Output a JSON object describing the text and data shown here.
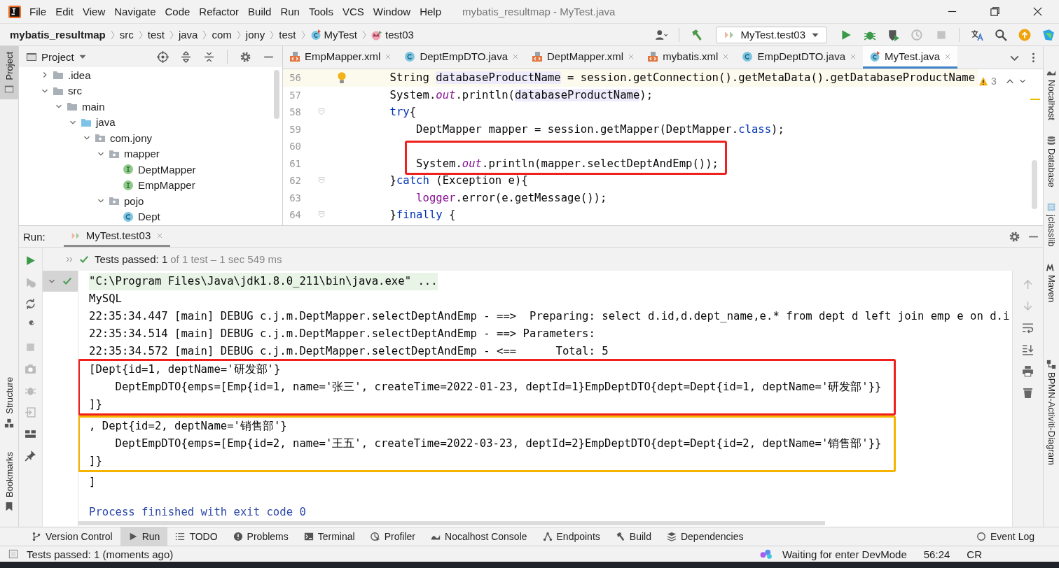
{
  "menu_bar": {
    "items": [
      "File",
      "Edit",
      "View",
      "Navigate",
      "Code",
      "Refactor",
      "Build",
      "Run",
      "Tools",
      "VCS",
      "Window",
      "Help"
    ],
    "title": "mybatis_resultmap - MyTest.java"
  },
  "breadcrumbs": [
    {
      "label": "mybatis_resultmap",
      "kind": "project"
    },
    {
      "label": "src",
      "kind": "dir"
    },
    {
      "label": "test",
      "kind": "dir"
    },
    {
      "label": "java",
      "kind": "dir"
    },
    {
      "label": "com",
      "kind": "dir"
    },
    {
      "label": "jony",
      "kind": "dir"
    },
    {
      "label": "test",
      "kind": "dir"
    },
    {
      "label": "MyTest",
      "kind": "class"
    },
    {
      "label": "test03",
      "kind": "method"
    }
  ],
  "toolbar": {
    "run_config": "MyTest.test03"
  },
  "left_stripe": [
    {
      "label": "Project",
      "selected": true
    },
    {
      "label": "Structure",
      "selected": false
    },
    {
      "label": "Bookmarks",
      "selected": false
    }
  ],
  "right_stripe": [
    "Nocalhost",
    "Database",
    "jclasslib",
    "Maven",
    "BPMN-Activiti-Diagram"
  ],
  "project": {
    "title": "Project",
    "tree": [
      {
        "label": ".idea",
        "kind": "folder",
        "expanded": false
      },
      {
        "label": "src",
        "kind": "folder",
        "expanded": true,
        "children": [
          {
            "label": "main",
            "kind": "folder",
            "expanded": true,
            "children": [
              {
                "label": "java",
                "kind": "source",
                "expanded": true,
                "children": [
                  {
                    "label": "com.jony",
                    "kind": "package",
                    "expanded": true,
                    "children": [
                      {
                        "label": "mapper",
                        "kind": "package",
                        "expanded": true,
                        "children": [
                          {
                            "label": "DeptMapper",
                            "kind": "interface"
                          },
                          {
                            "label": "EmpMapper",
                            "kind": "interface"
                          }
                        ]
                      },
                      {
                        "label": "pojo",
                        "kind": "package",
                        "expanded": true,
                        "children": [
                          {
                            "label": "Dept",
                            "kind": "class"
                          }
                        ]
                      }
                    ]
                  }
                ]
              }
            ]
          }
        ]
      }
    ]
  },
  "editor": {
    "tabs": [
      {
        "label": "EmpMapper.xml",
        "kind": "xml",
        "selected": false
      },
      {
        "label": "DeptEmpDTO.java",
        "kind": "class",
        "selected": false
      },
      {
        "label": "DeptMapper.xml",
        "kind": "xml",
        "selected": false
      },
      {
        "label": "mybatis.xml",
        "kind": "xml",
        "selected": false
      },
      {
        "label": "EmpDeptDTO.java",
        "kind": "class",
        "selected": false
      },
      {
        "label": "MyTest.java",
        "kind": "test-class",
        "selected": true
      }
    ],
    "warnings": "3",
    "blocks": [
      {
        "lines": [
          {
            "number": "56",
            "current": true,
            "intention": true,
            "tokens": [
              {
                "kind": "plain",
                "text": "    String "
              },
              {
                "kind": "usage",
                "text": "databaseProductName"
              },
              {
                "kind": "plain",
                "text": " = session.getConnection().getMetaData().getDatabaseProductName"
              }
            ]
          },
          {
            "number": "57",
            "current": false,
            "tokens": [
              {
                "kind": "plain",
                "text": "    System."
              },
              {
                "kind": "static",
                "text": "out"
              },
              {
                "kind": "plain",
                "text": ".println("
              },
              {
                "kind": "usage",
                "text": "databaseProductName"
              },
              {
                "kind": "plain",
                "text": ");"
              }
            ]
          },
          {
            "number": "58",
            "current": false,
            "foldable": true,
            "tokens": [
              {
                "kind": "keyword",
                "text": "    try"
              },
              {
                "kind": "plain",
                "text": "{"
              }
            ]
          },
          {
            "number": "59",
            "current": false,
            "tokens": [
              {
                "kind": "plain",
                "text": "        DeptMapper mapper = session.getMapper(DeptMapper."
              },
              {
                "kind": "keyword",
                "text": "class"
              },
              {
                "kind": "plain",
                "text": ");"
              }
            ]
          }
        ]
      },
      {
        "color": "#f0201e",
        "lines": [
          {
            "number": "60",
            "current": false
          },
          {
            "number": "61",
            "current": false,
            "tokens": [
              {
                "kind": "plain",
                "text": "        System."
              },
              {
                "kind": "static",
                "text": "out"
              },
              {
                "kind": "plain",
                "text": ".println(mapper.selectDeptAndEmp());"
              }
            ]
          }
        ]
      },
      {
        "lines": [
          {
            "number": "62",
            "current": false,
            "foldable": true,
            "tokens": [
              {
                "kind": "plain",
                "text": "    }"
              },
              {
                "kind": "keyword",
                "text": "catch"
              },
              {
                "kind": "plain",
                "text": " (Exception e){"
              }
            ]
          },
          {
            "number": "63",
            "current": false,
            "tokens": [
              {
                "kind": "field",
                "text": "        logger"
              },
              {
                "kind": "plain",
                "text": ".error(e.getMessage());"
              }
            ]
          },
          {
            "number": "64",
            "current": false,
            "foldable": true,
            "tokens": [
              {
                "kind": "plain",
                "text": "    }"
              },
              {
                "kind": "keyword",
                "text": "finally"
              },
              {
                "kind": "plain",
                "text": " {"
              }
            ]
          }
        ]
      }
    ]
  },
  "run": {
    "label": "Run:",
    "tab": "MyTest.test03",
    "status": "Tests passed: 1",
    "status_detail": "of 1 test – 1 sec 549 ms",
    "console": [
      {
        "lines": [
          {
            "kind": "command",
            "text": "\"C:\\Program Files\\Java\\jdk1.8.0_211\\bin\\java.exe\" ..."
          },
          {
            "kind": "output",
            "text": "MySQL"
          },
          {
            "kind": "output",
            "text": "22:35:34.447 [main] DEBUG c.j.m.DeptMapper.selectDeptAndEmp - ==>  Preparing: select d.id,d.dept_name,e.* from dept d left join emp e on d.i"
          },
          {
            "kind": "output",
            "text": "22:35:34.514 [main] DEBUG c.j.m.DeptMapper.selectDeptAndEmp - ==> Parameters: "
          },
          {
            "kind": "output",
            "text": "22:35:34.572 [main] DEBUG c.j.m.DeptMapper.selectDeptAndEmp - <==      Total: 5"
          }
        ]
      },
      {
        "color": "#f0201e",
        "lines": [
          {
            "kind": "output",
            "text": "[Dept{id=1, deptName='研发部'}"
          },
          {
            "kind": "output",
            "text": "    DeptEmpDTO{emps=[Emp{id=1, name='张三', createTime=2022-01-23, deptId=1}EmpDeptDTO{dept=Dept{id=1, deptName='研发部'}}"
          },
          {
            "kind": "output",
            "text": "]}"
          }
        ]
      },
      {
        "color": "#f5b400",
        "lines": [
          {
            "kind": "output",
            "text": ", Dept{id=2, deptName='销售部'}"
          },
          {
            "kind": "output",
            "text": "    DeptEmpDTO{emps=[Emp{id=2, name='王五', createTime=2022-03-23, deptId=2}EmpDeptDTO{dept=Dept{id=2, deptName='销售部'}}"
          },
          {
            "kind": "output",
            "text": "]}"
          }
        ]
      },
      {
        "lines": [
          {
            "kind": "output",
            "text": "]"
          },
          {
            "kind": "exit",
            "text": "Process finished with exit code 0"
          }
        ]
      }
    ]
  },
  "tool_windows": [
    {
      "label": "Version Control",
      "kind": "vcs",
      "selected": false
    },
    {
      "label": "Run",
      "kind": "run",
      "selected": true
    },
    {
      "label": "TODO",
      "kind": "todo",
      "selected": false
    },
    {
      "label": "Problems",
      "kind": "problems",
      "selected": false
    },
    {
      "label": "Terminal",
      "kind": "terminal",
      "selected": false
    },
    {
      "label": "Profiler",
      "kind": "profiler",
      "selected": false
    },
    {
      "label": "Nocalhost Console",
      "kind": "nocalhost",
      "selected": false
    },
    {
      "label": "Endpoints",
      "kind": "endpoints",
      "selected": false
    },
    {
      "label": "Build",
      "kind": "build",
      "selected": false
    },
    {
      "label": "Dependencies",
      "kind": "deps",
      "selected": false
    }
  ],
  "event_log": "Event Log",
  "status_bar": {
    "message": "Tests passed: 1 (moments ago)",
    "devmode": "Waiting for enter DevMode",
    "position": "56:24",
    "line_separator": "CR"
  }
}
